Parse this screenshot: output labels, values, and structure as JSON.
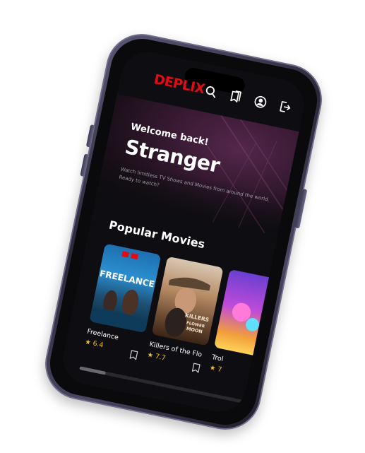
{
  "app": {
    "logo_text": "DEPLIX"
  },
  "nav": {
    "icons": [
      "search-icon",
      "bookmarks-icon",
      "profile-icon",
      "logout-icon"
    ]
  },
  "hero": {
    "welcome": "Welcome back!",
    "name": "Stranger",
    "description": "Watch limitless TV Shows and Movies from around the world. Ready to watch?"
  },
  "popular": {
    "title": "Popular Movies",
    "movies": [
      {
        "title": "Freelance",
        "rating": "★ 6.4"
      },
      {
        "title": "Killers of the Flo",
        "rating": "★ 7.7"
      },
      {
        "title": "Trol",
        "rating": "★ 7"
      }
    ]
  },
  "colors": {
    "brand": "#e50914",
    "rating": "#f4c21b",
    "background": "#0e0d11"
  }
}
